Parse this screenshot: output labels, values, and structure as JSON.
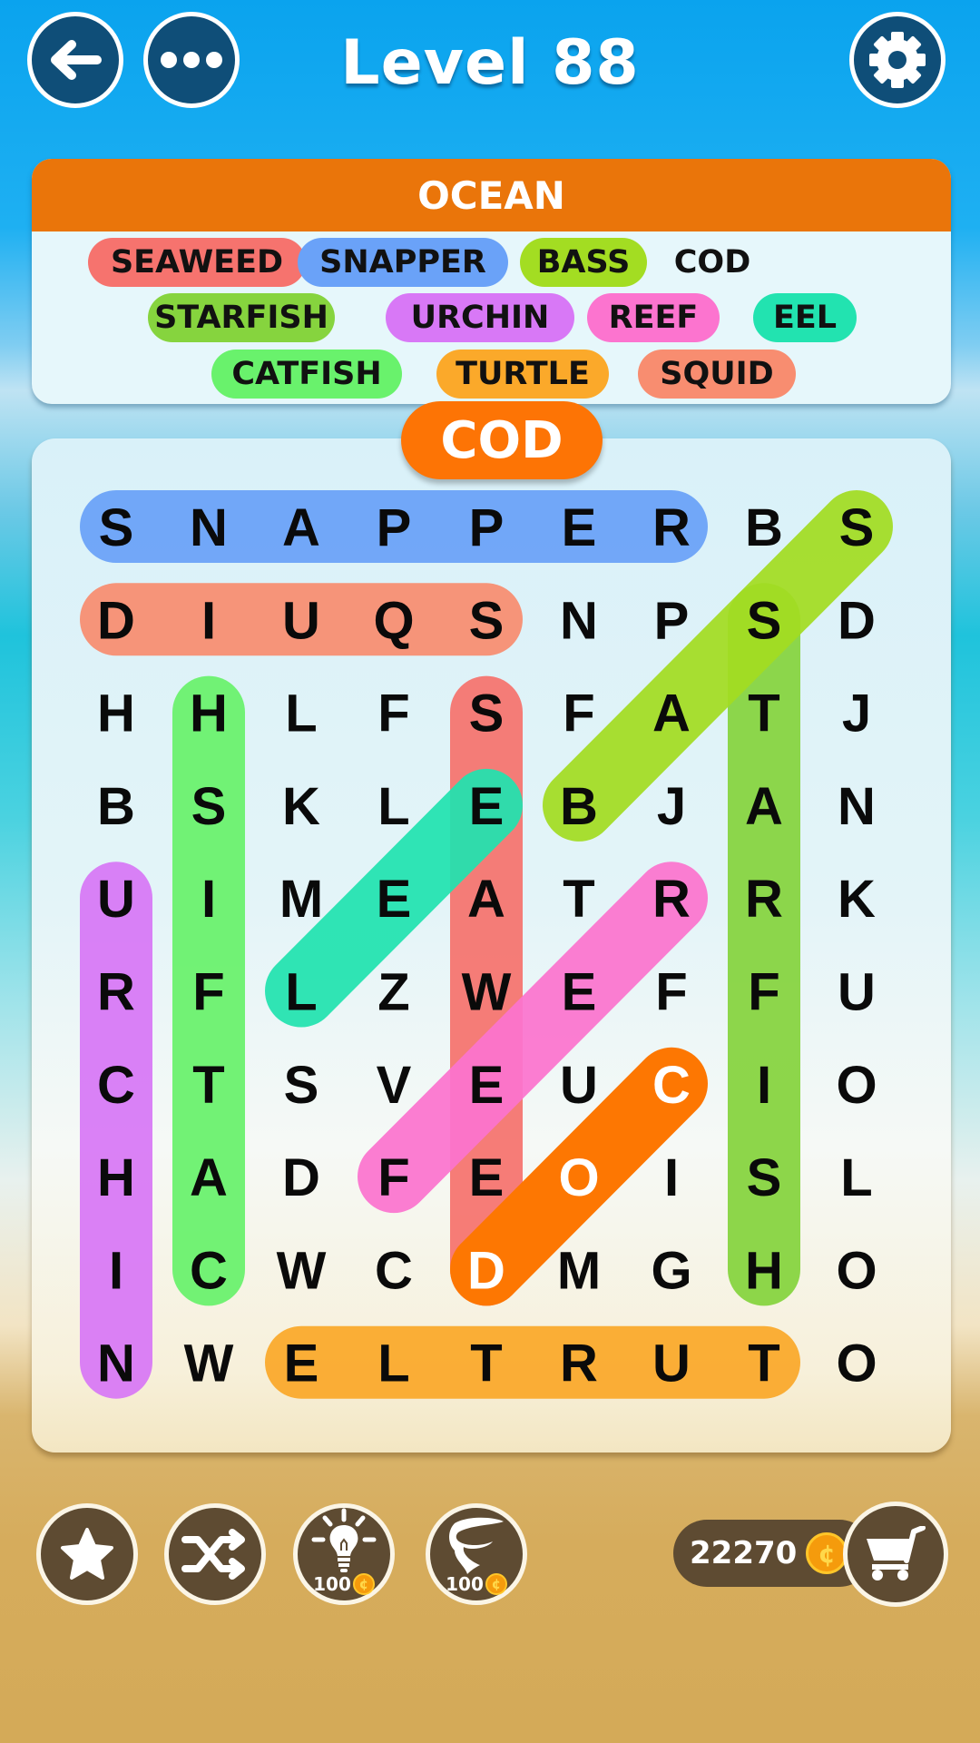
{
  "header": {
    "title": "Level 88",
    "back_icon": "arrow-left-icon",
    "more_icon": "more-dots-icon",
    "settings_icon": "gear-icon"
  },
  "theme": {
    "name": "OCEAN",
    "header_color": "#ea750a"
  },
  "words": [
    {
      "word": "SEAWEED",
      "found": true,
      "color": "#f6736e"
    },
    {
      "word": "SNAPPER",
      "found": true,
      "color": "#6aa2f8"
    },
    {
      "word": "BASS",
      "found": true,
      "color": "#a3dd22"
    },
    {
      "word": "COD",
      "found": false,
      "color": null
    },
    {
      "word": "STARFISH",
      "found": true,
      "color": "#86d43e"
    },
    {
      "word": "URCHIN",
      "found": true,
      "color": "#d878f6"
    },
    {
      "word": "REEF",
      "found": true,
      "color": "#fc74cf"
    },
    {
      "word": "EEL",
      "found": true,
      "color": "#22e3b0"
    },
    {
      "word": "CATFISH",
      "found": true,
      "color": "#69f26c"
    },
    {
      "word": "TURTLE",
      "found": true,
      "color": "#fba92a"
    },
    {
      "word": "SQUID",
      "found": true,
      "color": "#f88d70"
    }
  ],
  "current_selection": {
    "word": "COD",
    "color": "#fd7405"
  },
  "grid": {
    "rows": [
      "SNAPPERBS",
      "DIUQSNPSD",
      "HHLFSFATJ",
      "BSKLEBJAN",
      "UIMEATRRK",
      "RFLZWEFFU",
      "CTSVEUCIO",
      "HADFEOISL",
      "ICWCDMGHO",
      "NWELTRUTO"
    ],
    "highlights": [
      {
        "word": "SNAPPER",
        "from": [
          0,
          0
        ],
        "to": [
          6,
          0
        ],
        "color": "#6aa2f8"
      },
      {
        "word": "SQUID",
        "from": [
          4,
          1
        ],
        "to": [
          0,
          1
        ],
        "color": "#f88d70"
      },
      {
        "word": "SEAWEED",
        "from": [
          4,
          2
        ],
        "to": [
          4,
          8
        ],
        "color": "#f6736e"
      },
      {
        "word": "STARFISH",
        "from": [
          7,
          1
        ],
        "to": [
          7,
          8
        ],
        "color": "#86d43e"
      },
      {
        "word": "CATFISH",
        "from": [
          1,
          8
        ],
        "to": [
          1,
          2
        ],
        "color": "#69f26c"
      },
      {
        "word": "URCHIN",
        "from": [
          0,
          4
        ],
        "to": [
          0,
          9
        ],
        "color": "#d878f6"
      },
      {
        "word": "EEL",
        "from": [
          4,
          3
        ],
        "to": [
          2,
          5
        ],
        "color": "#22e3b0"
      },
      {
        "word": "BASS",
        "from": [
          5,
          3
        ],
        "to": [
          8,
          0
        ],
        "color": "#a3dd22"
      },
      {
        "word": "REEF",
        "from": [
          6,
          4
        ],
        "to": [
          3,
          7
        ],
        "color": "#fc74cf"
      },
      {
        "word": "TURTLE",
        "from": [
          7,
          9
        ],
        "to": [
          2,
          9
        ],
        "color": "#fba92a"
      },
      {
        "word": "COD",
        "from": [
          6,
          6
        ],
        "to": [
          4,
          8
        ],
        "color": "#fd7702",
        "active": true
      }
    ]
  },
  "toolbar": {
    "favorite_icon": "star-icon",
    "shuffle_icon": "shuffle-icon",
    "hint_icon": "lightbulb-icon",
    "hint_cost": "100",
    "tornado_icon": "tornado-icon",
    "tornado_cost": "100",
    "coin_icon": "coin-icon",
    "coins": "22270",
    "shop_icon": "cart-icon"
  }
}
